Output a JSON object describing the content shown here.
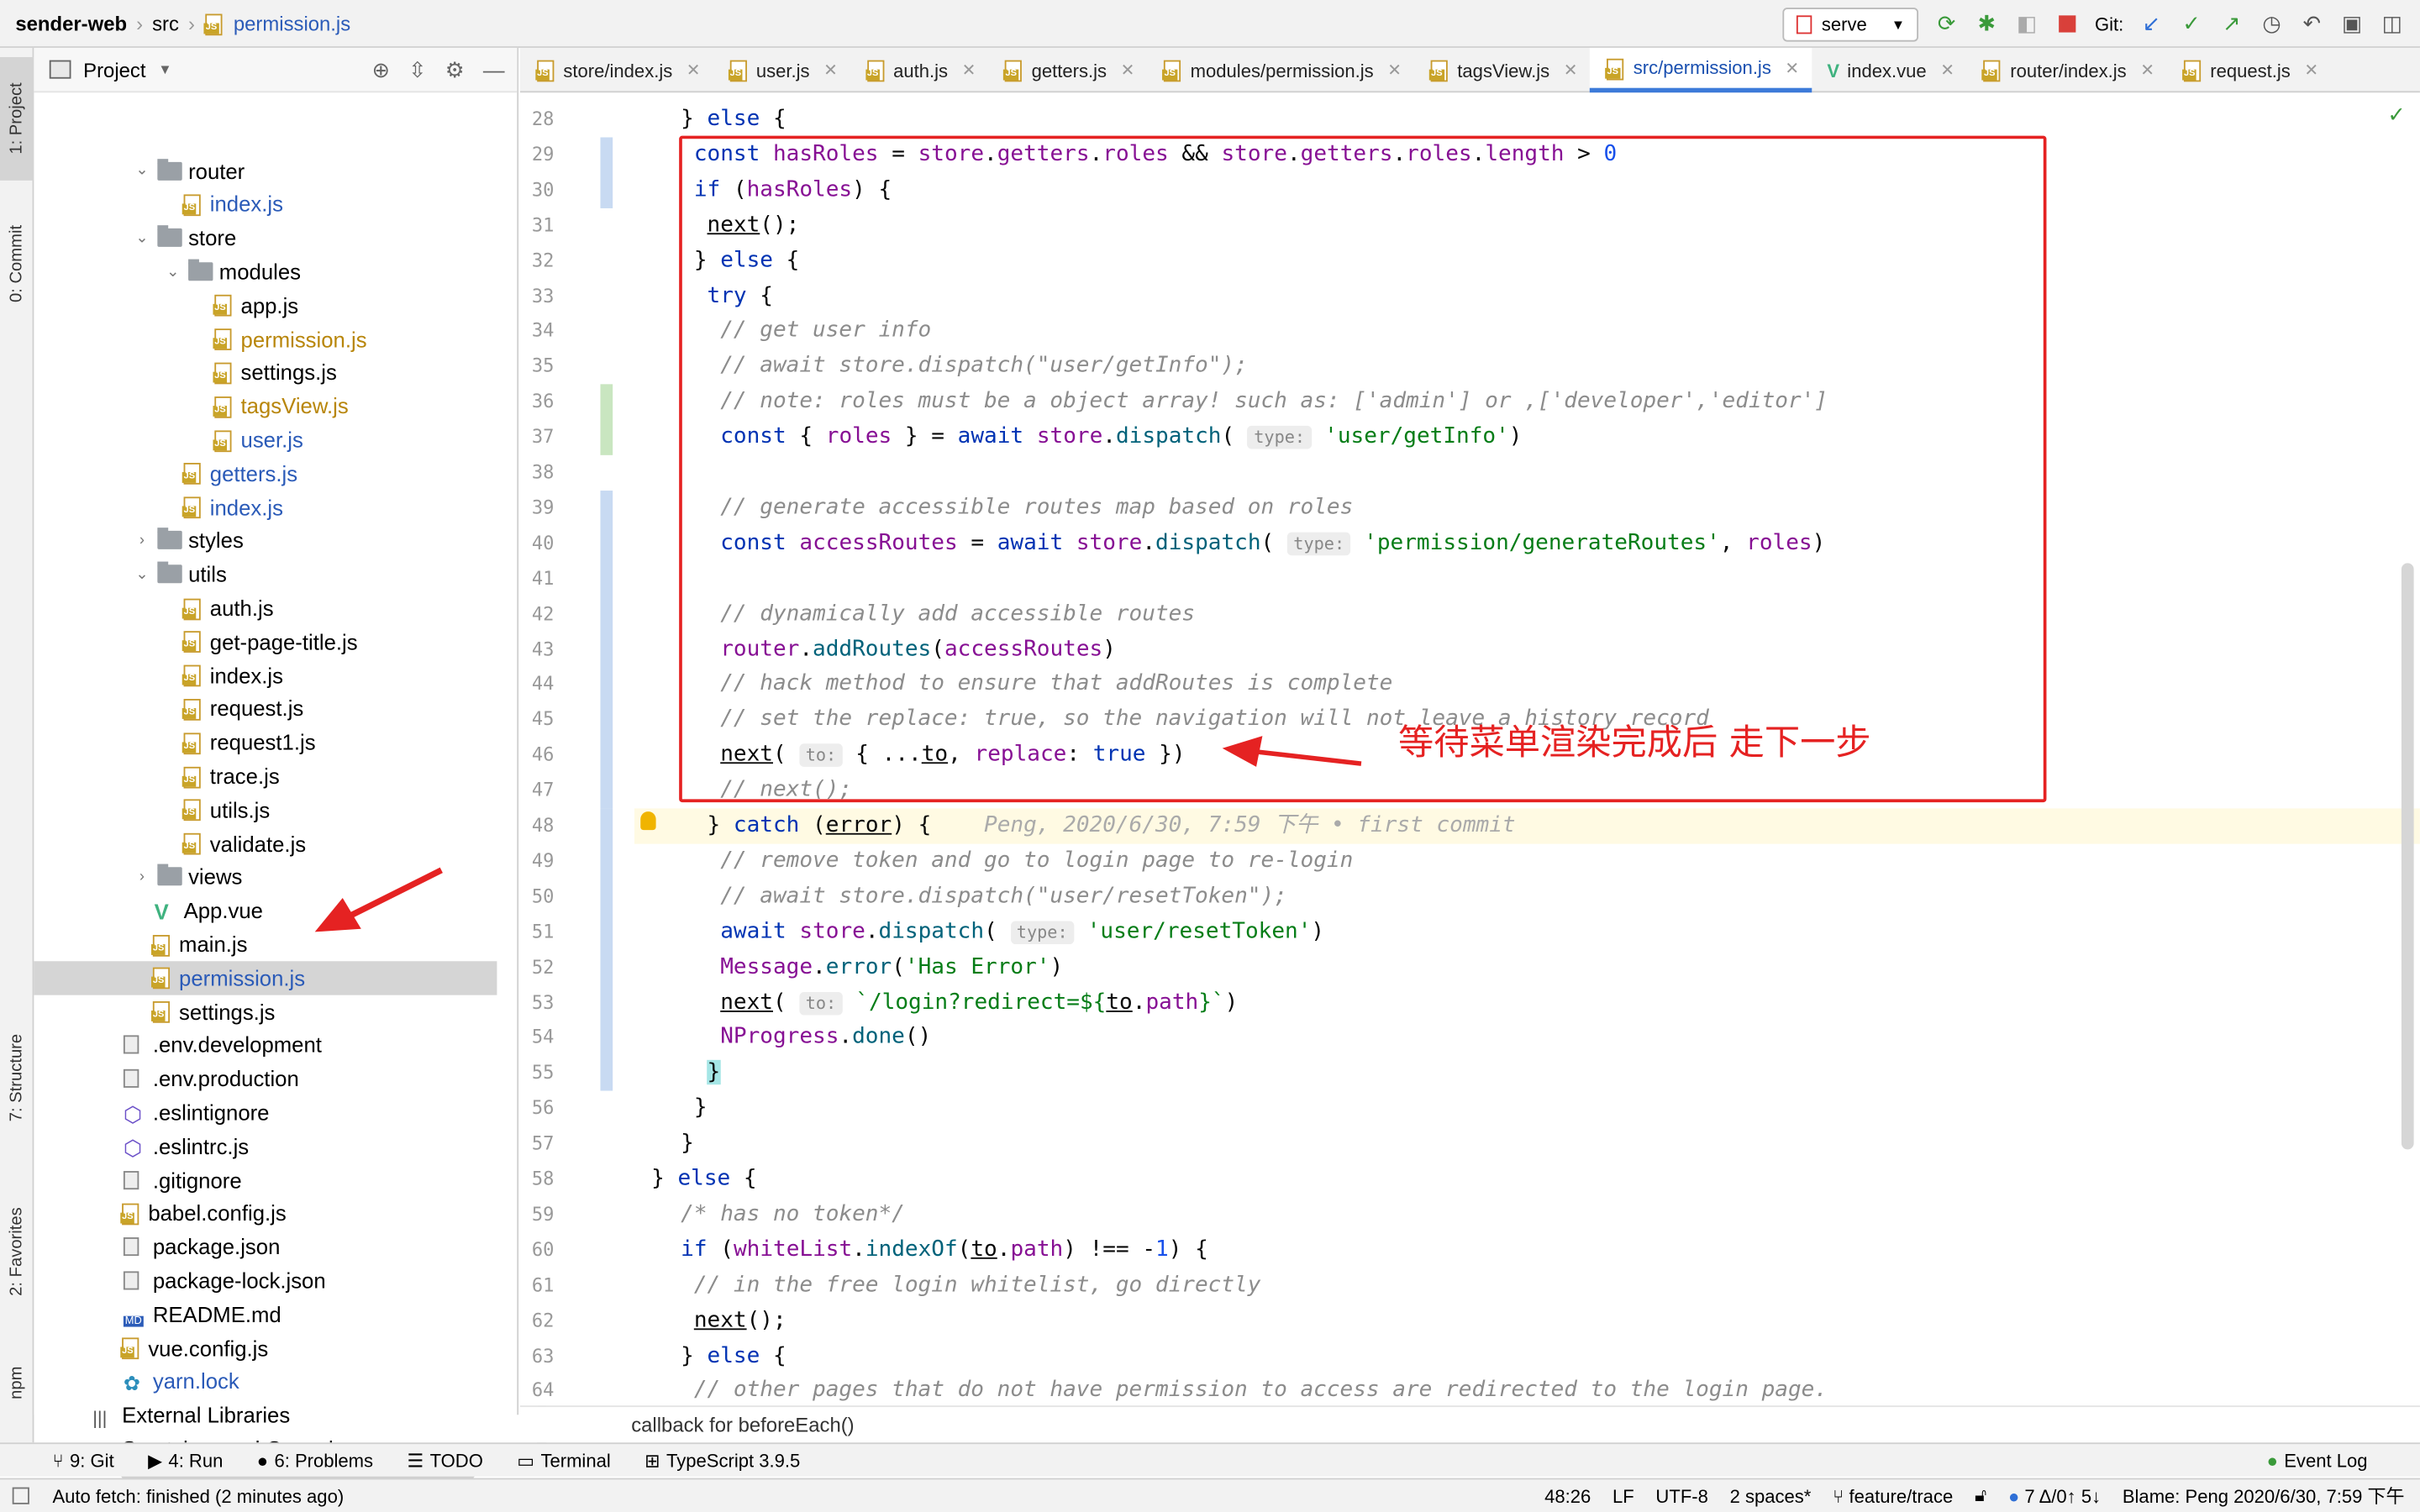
{
  "breadcrumb": {
    "project": "sender-web",
    "folder": "src",
    "file": "permission.js"
  },
  "toolbar": {
    "run_config": "serve",
    "git_label": "Git:"
  },
  "left_rail": {
    "project": "1: Project",
    "commit": "0: Commit",
    "structure": "7: Structure",
    "favorites": "2: Favorites",
    "npm": "npm"
  },
  "project_panel": {
    "title": "Project"
  },
  "tree": [
    {
      "label": "router",
      "type": "folder",
      "indent": 1,
      "open": true
    },
    {
      "label": "index.js",
      "type": "js",
      "indent": 2,
      "color": "blue"
    },
    {
      "label": "store",
      "type": "folder",
      "indent": 1,
      "open": true
    },
    {
      "label": "modules",
      "type": "folder",
      "indent": 2,
      "open": true
    },
    {
      "label": "app.js",
      "type": "js",
      "indent": 3
    },
    {
      "label": "permission.js",
      "type": "js",
      "indent": 3,
      "color": "mod"
    },
    {
      "label": "settings.js",
      "type": "js",
      "indent": 3
    },
    {
      "label": "tagsView.js",
      "type": "js",
      "indent": 3,
      "color": "mod"
    },
    {
      "label": "user.js",
      "type": "js",
      "indent": 3,
      "color": "blue"
    },
    {
      "label": "getters.js",
      "type": "js",
      "indent": 2,
      "color": "blue"
    },
    {
      "label": "index.js",
      "type": "js",
      "indent": 2,
      "color": "blue"
    },
    {
      "label": "styles",
      "type": "folder",
      "indent": 1,
      "open": false
    },
    {
      "label": "utils",
      "type": "folder",
      "indent": 1,
      "open": true
    },
    {
      "label": "auth.js",
      "type": "js",
      "indent": 2
    },
    {
      "label": "get-page-title.js",
      "type": "js",
      "indent": 2
    },
    {
      "label": "index.js",
      "type": "js",
      "indent": 2
    },
    {
      "label": "request.js",
      "type": "js",
      "indent": 2
    },
    {
      "label": "request1.js",
      "type": "js",
      "indent": 2
    },
    {
      "label": "trace.js",
      "type": "js",
      "indent": 2
    },
    {
      "label": "utils.js",
      "type": "js",
      "indent": 2
    },
    {
      "label": "validate.js",
      "type": "js",
      "indent": 2
    },
    {
      "label": "views",
      "type": "folder",
      "indent": 1,
      "open": false
    },
    {
      "label": "App.vue",
      "type": "vue",
      "indent": 1
    },
    {
      "label": "main.js",
      "type": "js",
      "indent": 1
    },
    {
      "label": "permission.js",
      "type": "js",
      "indent": 1,
      "color": "blue",
      "selected": true
    },
    {
      "label": "settings.js",
      "type": "js",
      "indent": 1
    },
    {
      "label": ".env.development",
      "type": "file",
      "indent": 0
    },
    {
      "label": ".env.production",
      "type": "file",
      "indent": 0
    },
    {
      "label": ".eslintignore",
      "type": "eslint",
      "indent": 0
    },
    {
      "label": ".eslintrc.js",
      "type": "eslint",
      "indent": 0
    },
    {
      "label": ".gitignore",
      "type": "file",
      "indent": 0
    },
    {
      "label": "babel.config.js",
      "type": "js",
      "indent": 0
    },
    {
      "label": "package.json",
      "type": "file",
      "indent": 0
    },
    {
      "label": "package-lock.json",
      "type": "file",
      "indent": 0
    },
    {
      "label": "README.md",
      "type": "md",
      "indent": 0
    },
    {
      "label": "vue.config.js",
      "type": "js",
      "indent": 0
    },
    {
      "label": "yarn.lock",
      "type": "yarn",
      "indent": 0,
      "color": "blue"
    },
    {
      "label": "External Libraries",
      "type": "lib",
      "indent": -1
    },
    {
      "label": "Scratches and Consoles",
      "type": "scratch",
      "indent": -1
    }
  ],
  "tabs": [
    {
      "label": "store/index.js",
      "icon": "js"
    },
    {
      "label": "user.js",
      "icon": "js"
    },
    {
      "label": "auth.js",
      "icon": "js"
    },
    {
      "label": "getters.js",
      "icon": "js"
    },
    {
      "label": "modules/permission.js",
      "icon": "js"
    },
    {
      "label": "tagsView.js",
      "icon": "js"
    },
    {
      "label": "src/permission.js",
      "icon": "js",
      "active": true
    },
    {
      "label": "index.vue",
      "icon": "vue"
    },
    {
      "label": "router/index.js",
      "icon": "js"
    },
    {
      "label": "request.js",
      "icon": "js"
    }
  ],
  "editor": {
    "first_line": 28,
    "annotation": "等待菜单渲染完成后 走下一步",
    "breadcrumb_footer": "callback for beforeEach()",
    "blame_inline": "Peng, 2020/6/30, 7:59 下午 • first commit"
  },
  "bottom_tools": {
    "git": "9: Git",
    "run": "4: Run",
    "problems": "6: Problems",
    "todo": "TODO",
    "terminal": "Terminal",
    "typescript": "TypeScript 3.9.5",
    "event_log": "Event Log"
  },
  "status": {
    "message": "Auto fetch: finished (2 minutes ago)",
    "position": "48:26",
    "line_ending": "LF",
    "encoding": "UTF-8",
    "indent": "2 spaces*",
    "branch": "feature/trace",
    "changes": "7 Δ/0↑ 5↓",
    "blame": "Blame: Peng 2020/6/30, 7:59 下午"
  }
}
